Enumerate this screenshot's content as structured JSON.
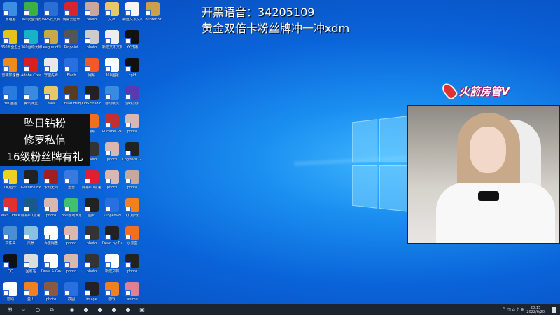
{
  "overlay": {
    "line1": "开黑语音：34205109",
    "line2": "黄金双倍卡粉丝牌冲一冲xdm",
    "box": [
      "坠日钻粉",
      "修罗私信",
      "16级粉丝牌有礼"
    ],
    "badge": "火箭房管V"
  },
  "desktop_rows": [
    [
      [
        "此电脑",
        "#3b8fe0"
      ],
      [
        "360安全浏览器",
        "#3cb043"
      ],
      [
        "WPS云文档",
        "#2b6fd6"
      ],
      [
        "网易云音乐",
        "#d9232d"
      ],
      [
        "photo",
        "#c9a79a"
      ],
      [
        "文档",
        "#e8c66a"
      ],
      [
        "新建文本文档",
        "#f5f5f5"
      ],
      [
        "Counter-Strike Global Offensive",
        "#caa14a"
      ]
    ],
    [
      [
        "360安全卫士",
        "#e6c21a"
      ],
      [
        "360驱动大师",
        "#18b3c8"
      ],
      [
        "League of Legends",
        "#c8a94a"
      ],
      [
        "Pinpoint",
        "#555555"
      ],
      [
        "photo",
        "#cccccc"
      ],
      [
        "新建文本文档",
        "#eeeeee"
      ],
      [
        "YY开播",
        "#111111"
      ]
    ],
    [
      [
        "雷神加速器",
        "#f08a1a"
      ],
      [
        "Adobe Creative Cloud",
        "#d82020"
      ],
      [
        "守望先锋",
        "#e8e8e8"
      ],
      [
        "Flash",
        "#2a6fe0"
      ],
      [
        "网易",
        "#f05a28"
      ],
      [
        "360画报",
        "#ffffff"
      ],
      [
        "cpld",
        "#111111"
      ]
    ],
    [
      [
        "360画画",
        "#2a7be0"
      ],
      [
        "腾讯课堂",
        "#3a8ae0"
      ],
      [
        "Yaos",
        "#e8c66a"
      ],
      [
        "Dread Hunger",
        "#5a3a20"
      ],
      [
        "OBS Studio",
        "#222222"
      ],
      [
        "驱动精灵",
        "#3a8ae0"
      ],
      [
        "游戏加加",
        "#5a3ab0"
      ]
    ],
    [
      null,
      null,
      null,
      null,
      [
        "网易",
        "#f07020"
      ],
      [
        "Pummel Party",
        "#c03030"
      ],
      [
        "photo",
        "#d8b8b0"
      ]
    ],
    [
      null,
      null,
      null,
      null,
      [
        "photo",
        "#333333"
      ],
      [
        "photo",
        "#d8b8b0"
      ],
      [
        "Logitech G HUB",
        "#222222"
      ]
    ],
    [
      [
        "QQ音乐",
        "#f0d020"
      ],
      [
        "GeForce Experience",
        "#222222"
      ],
      [
        "永劫无间",
        "#a02020"
      ],
      [
        "迅雷",
        "#3a7ae0"
      ],
      [
        "网易UU加速器",
        "#e02030"
      ],
      [
        "photo",
        "#d8b8b0"
      ],
      [
        "photo",
        "#c9a79a"
      ]
    ],
    [
      [
        "WPS Office",
        "#e03030"
      ],
      [
        "网易UU加速器",
        "#1a5a8a"
      ],
      [
        "photo",
        "#d8b8b0"
      ],
      [
        "360游戏大厅",
        "#40c070"
      ],
      [
        "图片",
        "#222222"
      ],
      [
        "XunJieVPN",
        "#2a6fe0"
      ],
      [
        "QQ游戏",
        "#f08020"
      ]
    ],
    [
      [
        "文件夹",
        "#4a90d0"
      ],
      [
        "风景",
        "#8ac0e0"
      ],
      [
        "百度网盘",
        "#ffffff"
      ],
      [
        "photo",
        "#d8b8b0"
      ],
      [
        "photo",
        "#333333"
      ],
      [
        "Dead by Daylight",
        "#222222"
      ],
      [
        "小黑盒",
        "#f07020"
      ]
    ],
    [
      [
        "QQ",
        "#111111"
      ],
      [
        "回收站",
        "#dddddd"
      ],
      [
        "Draw & Guess",
        "#ffffff"
      ],
      [
        "photo",
        "#d8b8b0"
      ],
      [
        "photo",
        "#333333"
      ],
      [
        "新建文档",
        "#ffffff"
      ],
      [
        "photo",
        "#222222"
      ]
    ],
    [
      [
        "帮助",
        "#ffffff"
      ],
      [
        "金山",
        "#f08020"
      ],
      [
        "photo",
        "#8a5a40"
      ],
      [
        "截图",
        "#2a6fe0"
      ],
      [
        "image",
        "#222222"
      ],
      [
        "游戏",
        "#f08020"
      ],
      [
        "anime",
        "#e08090"
      ]
    ]
  ],
  "taskbar": {
    "items": [
      [
        "start-button",
        "⊞"
      ],
      [
        "search-button",
        "⌕"
      ],
      [
        "cortana-button",
        "○"
      ],
      [
        "task-view-button",
        "⧉"
      ],
      [
        "edge-app",
        "◉"
      ],
      [
        "360-app",
        "●"
      ],
      [
        "chrome-app",
        "●"
      ],
      [
        "yy-app",
        "●"
      ],
      [
        "obs-app",
        "●"
      ],
      [
        "app",
        "▣"
      ]
    ],
    "tray": "^ ◫ ⌂ ♪ ⊕",
    "time": "20:15",
    "date": "2022/6/20"
  }
}
